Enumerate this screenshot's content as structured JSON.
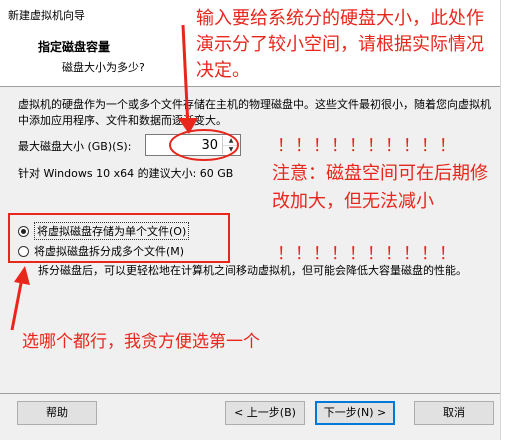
{
  "window": {
    "title": "新建虚拟机向导"
  },
  "header": {
    "title": "指定磁盘容量",
    "subtitle": "磁盘大小为多少?"
  },
  "body": {
    "description": "虚拟机的硬盘作为一个或多个文件存储在主机的物理磁盘中。这些文件最初很小，随着您向虚拟机中添加应用程序、文件和数据而逐渐变大。",
    "max_disk_label": "最大磁盘大小 (GB)(S):",
    "max_disk_value": "30",
    "recommended": "针对 Windows 10 x64 的建议大小: 60 GB",
    "radio_single": "将虚拟磁盘存储为单个文件(O)",
    "radio_multi": "将虚拟磁盘拆分成多个文件(M)",
    "split_note": "拆分磁盘后，可以更轻松地在计算机之间移动虚拟机，但可能会降低大容量磁盘的性能。"
  },
  "buttons": {
    "help": "帮助",
    "back": "< 上一步(B)",
    "next": "下一步(N) >",
    "cancel": "取消"
  },
  "annotations": {
    "top": "输入要给系统分的硬盘大小，此处作演示分了较小空间，请根据实际情况决定。",
    "exclaim_1": "！！！！！！！！！！",
    "warning": "注意：磁盘空间可在后期修改加大，但无法减小",
    "exclaim_2": "！！！！！！！！！！",
    "bottom": "选哪个都行，我贪方便选第一个",
    "color": "#e8261c"
  }
}
